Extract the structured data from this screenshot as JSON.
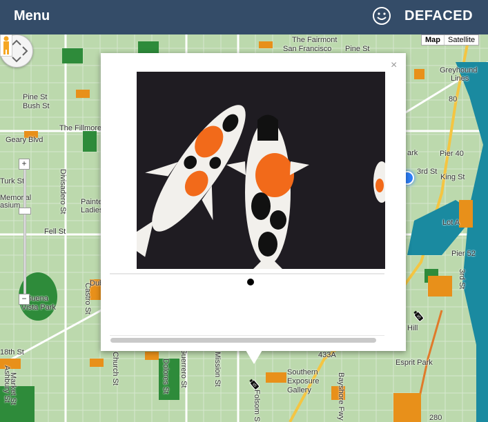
{
  "header": {
    "menu_label": "Menu",
    "brand": "DEFACED",
    "smiley_icon": "smiley-icon"
  },
  "map_type": {
    "map": "Map",
    "satellite": "Satellite"
  },
  "zoom": {
    "plus": "+",
    "minus": "−"
  },
  "map_labels": [
    "The Fairmont",
    "San Francisco",
    "Pine St",
    "Greyhound",
    "Lines",
    "The Fillmore",
    "Geary Blvd",
    "Divisadero St",
    "Turk St",
    "Memorial",
    "asium",
    "Painted",
    "Ladies",
    "Fell St",
    "Pier 40",
    "3rd St",
    "King St",
    "Lot A",
    "Pier 52",
    "Buena",
    "Vista Park",
    "Castro St",
    "Duboce",
    "Dolores St",
    "Guerrero St",
    "Mission St",
    "Southern",
    "Exposure",
    "Gallery",
    "Bayshore Fwy",
    "Esprit Park",
    "Market St",
    "Church St",
    "Folsom St",
    "Ashbury St",
    "Hill",
    "18th St",
    "Pine St",
    "Bush St",
    "ark",
    "80",
    "280",
    "433A",
    "3rd St"
  ],
  "popup": {
    "close": "×"
  },
  "colors": {
    "header_bg": "#344c68",
    "map_bg": "#b6d7a8",
    "accent_orange": "#e8901a",
    "park_green": "#1d7a2c"
  }
}
